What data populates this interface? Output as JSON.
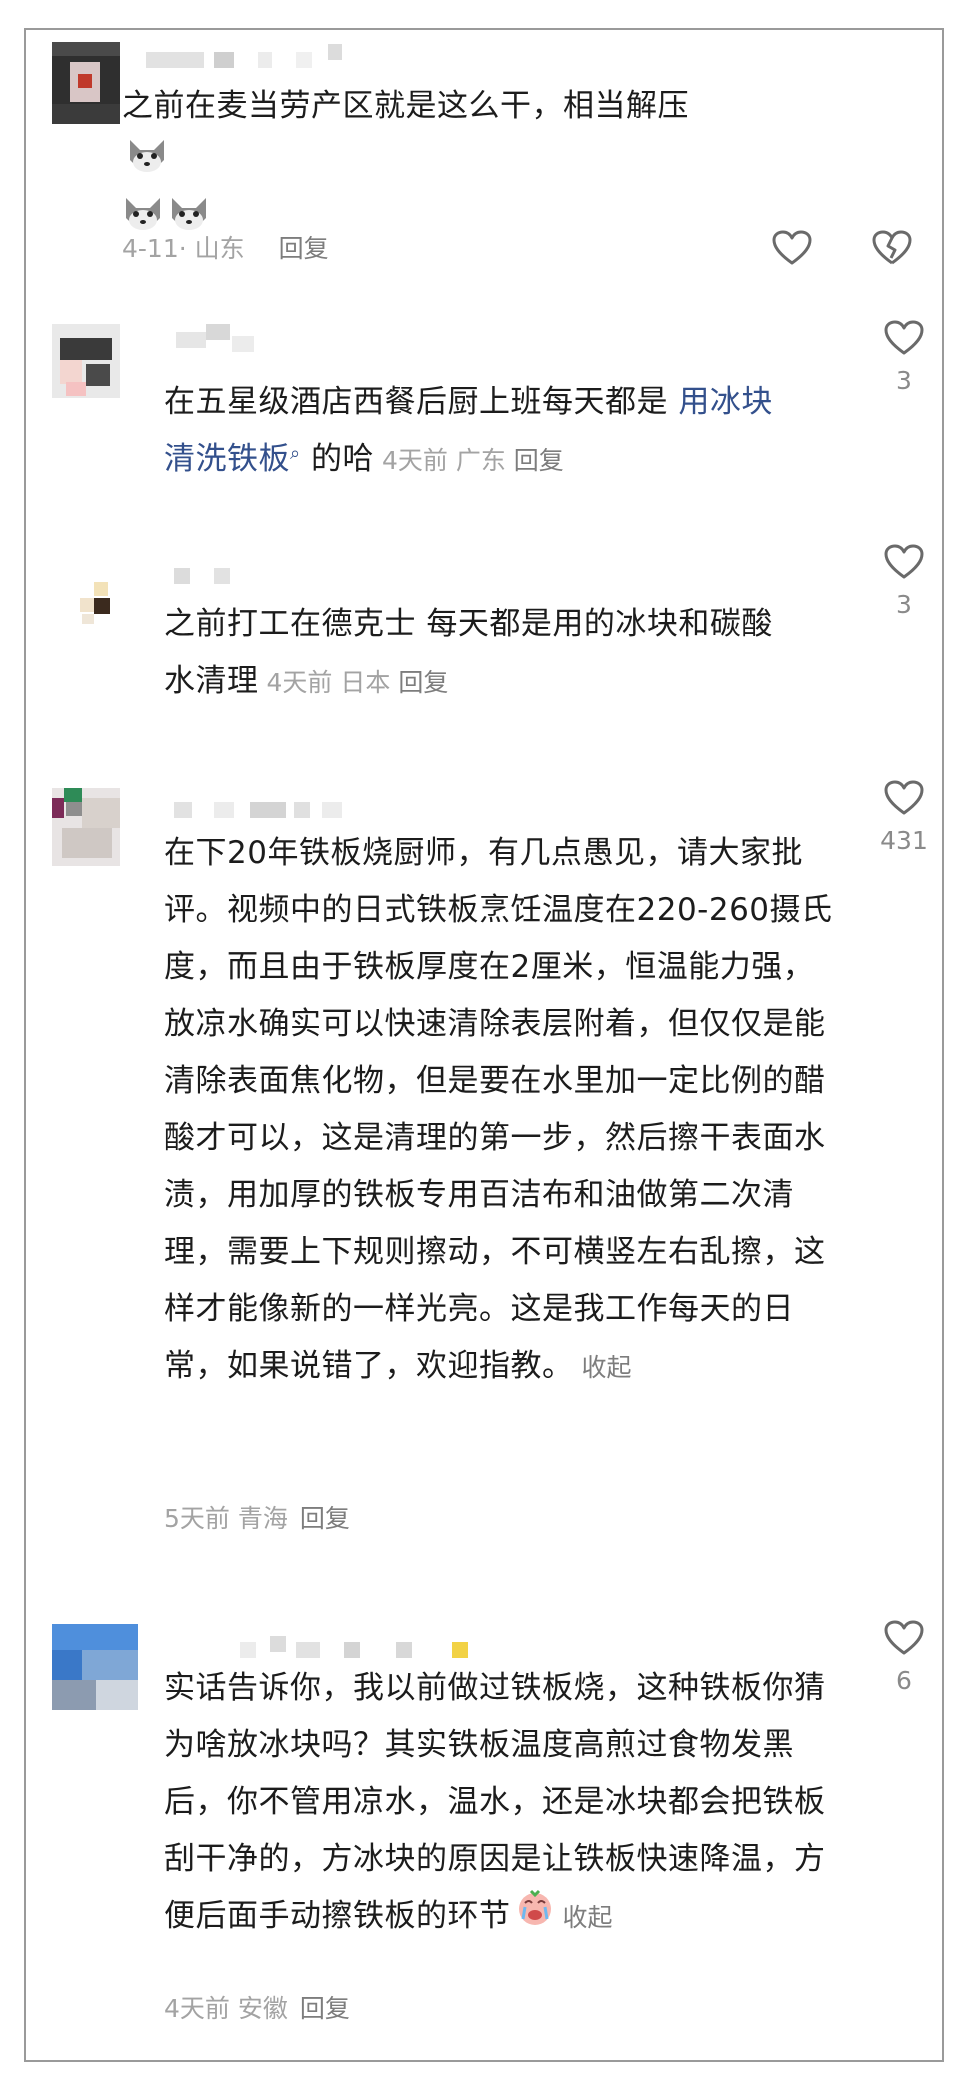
{
  "comments": [
    {
      "text_line1": "之前在麦当劳产区就是这么干，相当解压",
      "date": "4-11",
      "separator": "·",
      "location": "山东",
      "reply_label": "回复",
      "emoji": "husky-emoji"
    },
    {
      "text_part1": "在五星级酒店西餐后厨上班每天都是 ",
      "link_text": "用冰块清洗铁板",
      "text_part2": " 的哈",
      "time": "4天前",
      "location": "广东",
      "reply_label": "回复",
      "like_count": "3"
    },
    {
      "text": "之前打工在德克士 每天都是用的冰块和碳酸水清理",
      "time": "4天前",
      "location": "日本",
      "reply_label": "回复",
      "like_count": "3"
    },
    {
      "text": "在下20年铁板烧厨师，有几点愚见，请大家批评。视频中的日式铁板烹饪温度在220-260摄氏度，而且由于铁板厚度在2厘米，恒温能力强，放凉水确实可以快速清除表层附着，但仅仅是能清除表面焦化物，但是要在水里加一定比例的醋酸才可以，这是清理的第一步，然后擦干表面水渍，用加厚的铁板专用百洁布和油做第二次清理，需要上下规则擦动，不可横竖左右乱擦，这样才能像新的一样光亮。这是我工作每天的日常，如果说错了，欢迎指教。",
      "collapse_label": "收起",
      "time": "5天前",
      "location": "青海",
      "reply_label": "回复",
      "like_count": "431"
    },
    {
      "text": "实话告诉你，我以前做过铁板烧，这种铁板你猜为啥放冰块吗？其实铁板温度高煎过食物发黑后，你不管用凉水，温水，还是冰块都会把铁板刮干净的，方冰块的原因是让铁板快速降温，方便后面手动擦铁板的环节",
      "collapse_label": "收起",
      "time": "4天前",
      "location": "安徽",
      "reply_label": "回复",
      "like_count": "6",
      "emoji": "crying-face-emoji"
    }
  ],
  "colors": {
    "text": "#1c1c1c",
    "meta": "#a3a3a3",
    "link": "#33508c",
    "icon": "#6a6a6a"
  }
}
